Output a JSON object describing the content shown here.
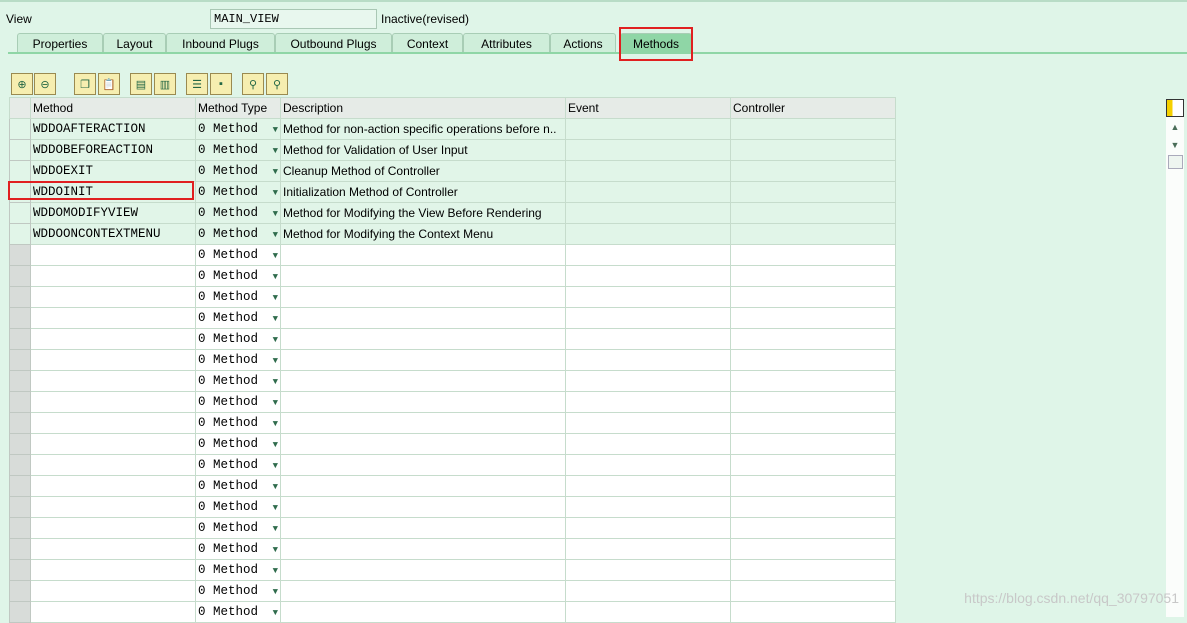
{
  "header": {
    "view_label": "View",
    "view_value": "MAIN_VIEW",
    "status": "Inactive(revised)"
  },
  "tabs": [
    "Properties",
    "Layout",
    "Inbound Plugs",
    "Outbound Plugs",
    "Context",
    "Attributes",
    "Actions",
    "Methods"
  ],
  "active_tab": "Methods",
  "toolbar": [
    "insert-row-icon",
    "delete-row-icon",
    "copy-icon",
    "paste-icon",
    "import-icon",
    "export-icon",
    "details-icon",
    "select-icon",
    "find-icon",
    "find-next-icon"
  ],
  "table": {
    "columns": [
      "Method",
      "Method Type",
      "Description",
      "Event",
      "Controller"
    ],
    "rows": [
      {
        "method": "WDDOAFTERACTION",
        "type": "0 Method",
        "description": "Method for non-action specific operations before n..",
        "event": "",
        "controller": ""
      },
      {
        "method": "WDDOBEFOREACTION",
        "type": "0 Method",
        "description": "Method for Validation of User Input",
        "event": "",
        "controller": ""
      },
      {
        "method": "WDDOEXIT",
        "type": "0 Method",
        "description": "Cleanup Method of Controller",
        "event": "",
        "controller": ""
      },
      {
        "method": "WDDOINIT",
        "type": "0 Method",
        "description": "Initialization Method of Controller",
        "event": "",
        "controller": ""
      },
      {
        "method": "WDDOMODIFYVIEW",
        "type": "0 Method",
        "description": "Method for Modifying the View Before Rendering",
        "event": "",
        "controller": ""
      },
      {
        "method": "WDDOONCONTEXTMENU",
        "type": "0 Method",
        "description": "Method for Modifying the Context Menu",
        "event": "",
        "controller": ""
      }
    ],
    "empty_row_type": "0 Method",
    "empty_row_count": 18
  },
  "watermark": "https://blog.csdn.net/qq_30797051"
}
